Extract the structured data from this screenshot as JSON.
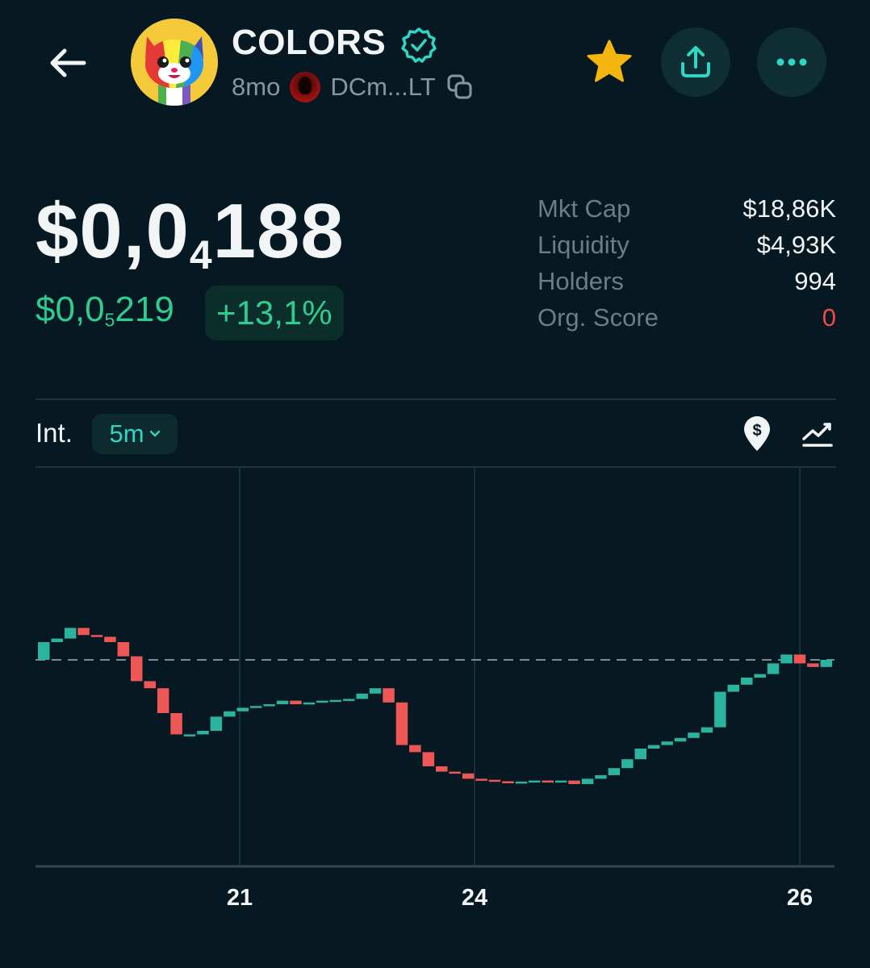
{
  "header": {
    "token_name": "COLORS",
    "age": "8mo",
    "creator_address": "DCm...LT",
    "icons": [
      "back-arrow-icon",
      "verified-badge-icon",
      "copy-icon",
      "star-icon",
      "share-icon",
      "more-icon"
    ]
  },
  "price": {
    "prefix": "$0,0",
    "zeros": "4",
    "digits": "188"
  },
  "change": {
    "prefix": "$0,0",
    "zeros": "5",
    "digits": "219",
    "percent": "+13,1%"
  },
  "stats": [
    {
      "label": "Mkt Cap",
      "value": "$18,86K"
    },
    {
      "label": "Liquidity",
      "value": "$4,93K"
    },
    {
      "label": "Holders",
      "value": "994"
    },
    {
      "label": "Org. Score",
      "value": "0"
    }
  ],
  "interval": {
    "label": "Int.",
    "value": "5m"
  },
  "colors": {
    "background": "#061821",
    "up": "#2bb3a0",
    "down": "#ef5757",
    "positive_text": "#2ecc8e",
    "accent": "#2fd6c4",
    "star": "#f5b50f",
    "negative_score": "#f0494b"
  },
  "chart_data": {
    "type": "candlestick",
    "x_ticks": [
      "21",
      "24",
      "26"
    ],
    "current_price_line": 0.55,
    "y_range": [
      0.0,
      1.0
    ],
    "candles": [
      {
        "o": 0.55,
        "c": 0.6,
        "dir": "up"
      },
      {
        "o": 0.6,
        "c": 0.61,
        "dir": "up"
      },
      {
        "o": 0.61,
        "c": 0.64,
        "dir": "up"
      },
      {
        "o": 0.64,
        "c": 0.62,
        "dir": "down"
      },
      {
        "o": 0.62,
        "c": 0.615,
        "dir": "down"
      },
      {
        "o": 0.615,
        "c": 0.6,
        "dir": "down"
      },
      {
        "o": 0.6,
        "c": 0.56,
        "dir": "down"
      },
      {
        "o": 0.56,
        "c": 0.49,
        "dir": "down"
      },
      {
        "o": 0.49,
        "c": 0.47,
        "dir": "down"
      },
      {
        "o": 0.47,
        "c": 0.4,
        "dir": "down"
      },
      {
        "o": 0.4,
        "c": 0.34,
        "dir": "down"
      },
      {
        "o": 0.34,
        "c": 0.34,
        "dir": "up"
      },
      {
        "o": 0.34,
        "c": 0.35,
        "dir": "up"
      },
      {
        "o": 0.35,
        "c": 0.39,
        "dir": "up"
      },
      {
        "o": 0.39,
        "c": 0.405,
        "dir": "up"
      },
      {
        "o": 0.405,
        "c": 0.415,
        "dir": "up"
      },
      {
        "o": 0.415,
        "c": 0.42,
        "dir": "up"
      },
      {
        "o": 0.42,
        "c": 0.425,
        "dir": "up"
      },
      {
        "o": 0.425,
        "c": 0.435,
        "dir": "up"
      },
      {
        "o": 0.435,
        "c": 0.425,
        "dir": "down"
      },
      {
        "o": 0.425,
        "c": 0.43,
        "dir": "up"
      },
      {
        "o": 0.43,
        "c": 0.435,
        "dir": "up"
      },
      {
        "o": 0.435,
        "c": 0.437,
        "dir": "up"
      },
      {
        "o": 0.437,
        "c": 0.44,
        "dir": "up"
      },
      {
        "o": 0.44,
        "c": 0.455,
        "dir": "up"
      },
      {
        "o": 0.455,
        "c": 0.47,
        "dir": "up"
      },
      {
        "o": 0.47,
        "c": 0.43,
        "dir": "down"
      },
      {
        "o": 0.43,
        "c": 0.31,
        "dir": "down"
      },
      {
        "o": 0.31,
        "c": 0.29,
        "dir": "down"
      },
      {
        "o": 0.29,
        "c": 0.25,
        "dir": "down"
      },
      {
        "o": 0.25,
        "c": 0.235,
        "dir": "down"
      },
      {
        "o": 0.235,
        "c": 0.23,
        "dir": "down"
      },
      {
        "o": 0.23,
        "c": 0.215,
        "dir": "down"
      },
      {
        "o": 0.215,
        "c": 0.212,
        "dir": "down"
      },
      {
        "o": 0.212,
        "c": 0.208,
        "dir": "down"
      },
      {
        "o": 0.208,
        "c": 0.205,
        "dir": "down"
      },
      {
        "o": 0.205,
        "c": 0.207,
        "dir": "up"
      },
      {
        "o": 0.207,
        "c": 0.21,
        "dir": "up"
      },
      {
        "o": 0.21,
        "c": 0.208,
        "dir": "down"
      },
      {
        "o": 0.208,
        "c": 0.21,
        "dir": "up"
      },
      {
        "o": 0.21,
        "c": 0.2,
        "dir": "down"
      },
      {
        "o": 0.2,
        "c": 0.215,
        "dir": "up"
      },
      {
        "o": 0.215,
        "c": 0.225,
        "dir": "up"
      },
      {
        "o": 0.225,
        "c": 0.245,
        "dir": "up"
      },
      {
        "o": 0.245,
        "c": 0.27,
        "dir": "up"
      },
      {
        "o": 0.27,
        "c": 0.3,
        "dir": "up"
      },
      {
        "o": 0.3,
        "c": 0.31,
        "dir": "up"
      },
      {
        "o": 0.31,
        "c": 0.32,
        "dir": "up"
      },
      {
        "o": 0.32,
        "c": 0.33,
        "dir": "up"
      },
      {
        "o": 0.33,
        "c": 0.345,
        "dir": "up"
      },
      {
        "o": 0.345,
        "c": 0.36,
        "dir": "up"
      },
      {
        "o": 0.36,
        "c": 0.46,
        "dir": "up"
      },
      {
        "o": 0.46,
        "c": 0.48,
        "dir": "up"
      },
      {
        "o": 0.48,
        "c": 0.5,
        "dir": "up"
      },
      {
        "o": 0.5,
        "c": 0.51,
        "dir": "up"
      },
      {
        "o": 0.51,
        "c": 0.54,
        "dir": "up"
      },
      {
        "o": 0.54,
        "c": 0.565,
        "dir": "up"
      },
      {
        "o": 0.565,
        "c": 0.54,
        "dir": "down"
      },
      {
        "o": 0.54,
        "c": 0.53,
        "dir": "down"
      },
      {
        "o": 0.53,
        "c": 0.55,
        "dir": "up"
      }
    ]
  }
}
